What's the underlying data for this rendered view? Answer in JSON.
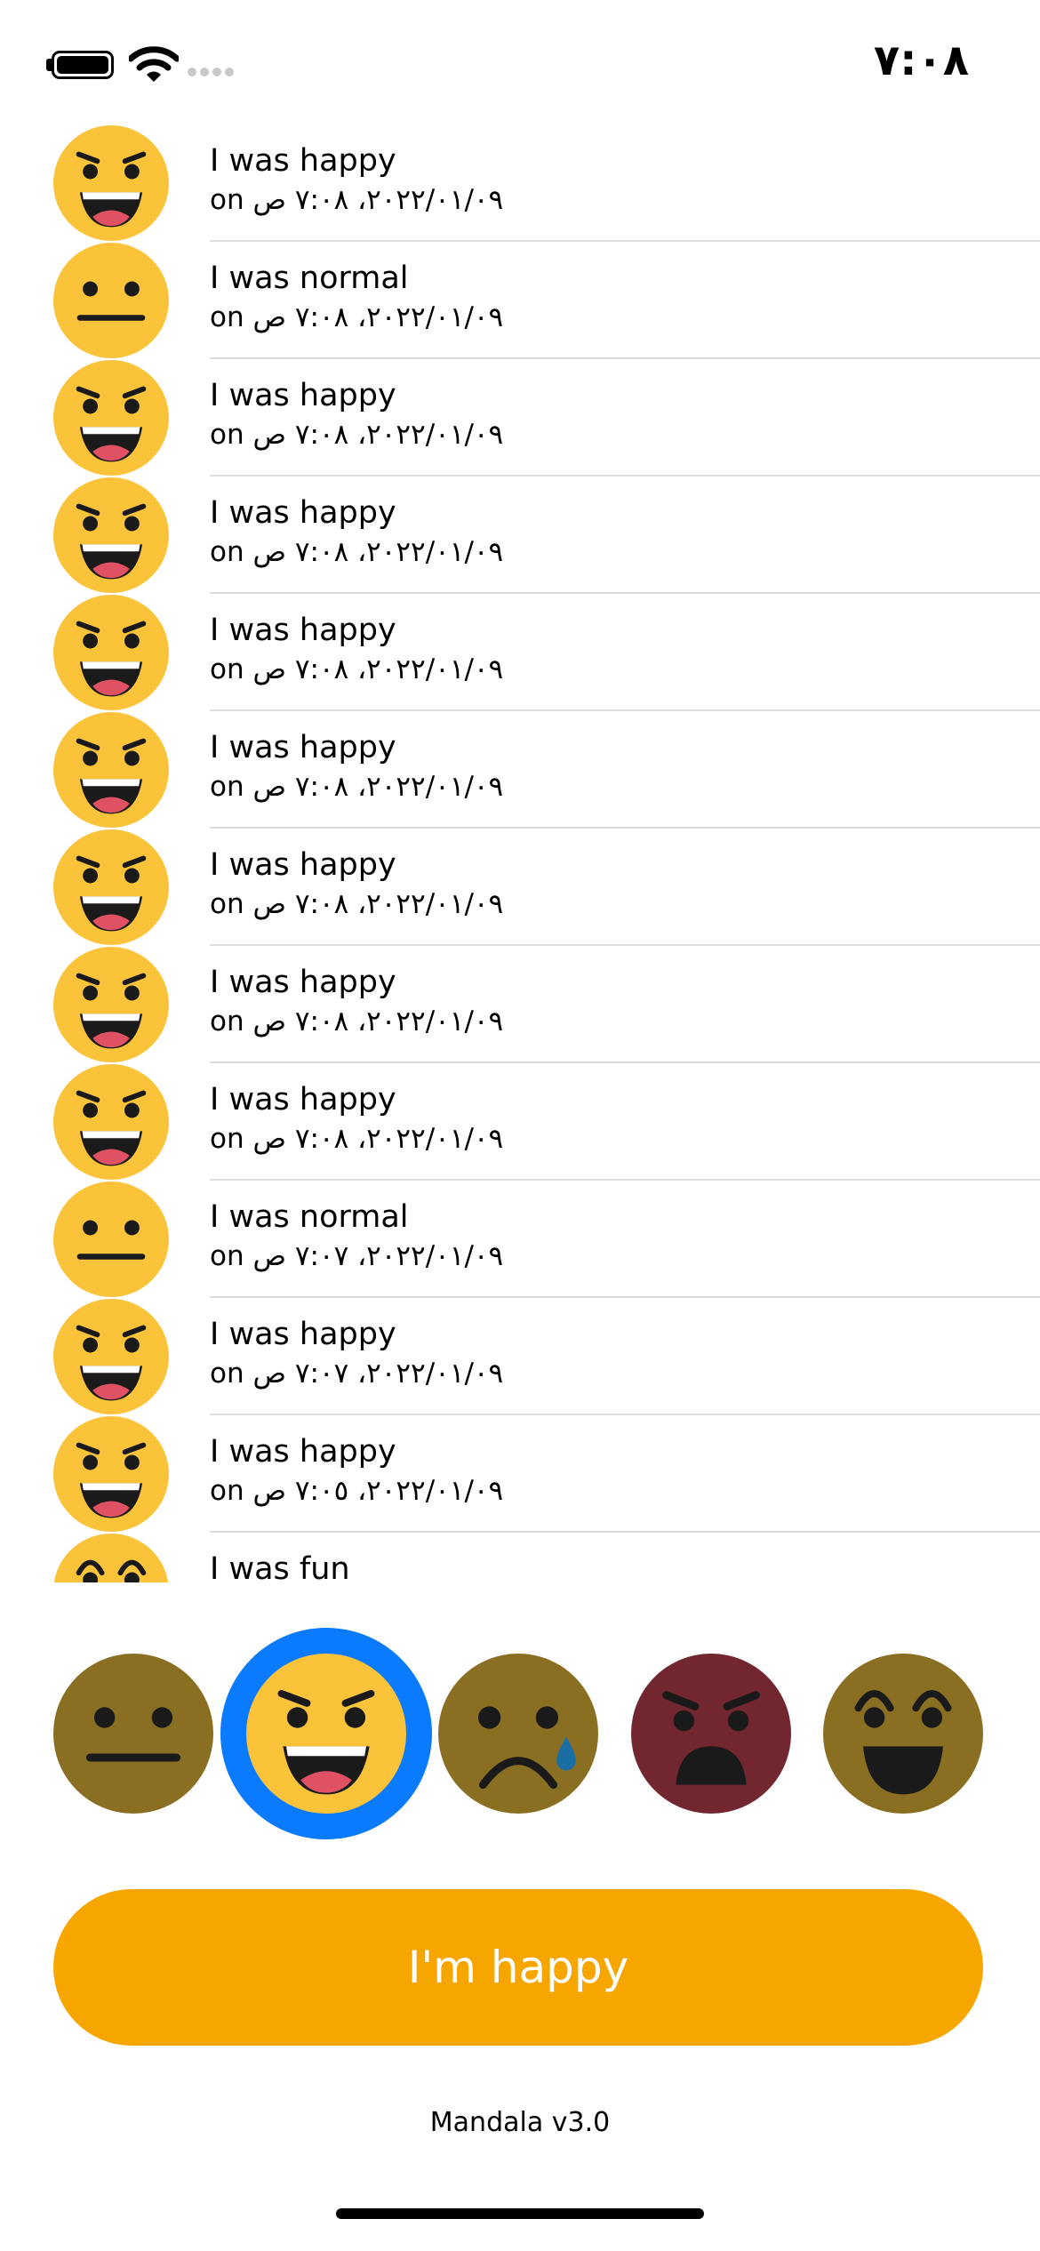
{
  "status_bar": {
    "time": "٧:٠٨",
    "icons": [
      "battery-icon",
      "wifi-icon",
      "cellular-signal-icon"
    ]
  },
  "history": [
    {
      "mood": "happy",
      "title": "I was happy",
      "prefix": "on",
      "datetime": "٢٠٢٢/٠١/٠٩، ٧:٠٨ ص"
    },
    {
      "mood": "normal",
      "title": "I was normal",
      "prefix": "on",
      "datetime": "٢٠٢٢/٠١/٠٩، ٧:٠٨ ص"
    },
    {
      "mood": "happy",
      "title": "I was happy",
      "prefix": "on",
      "datetime": "٢٠٢٢/٠١/٠٩، ٧:٠٨ ص"
    },
    {
      "mood": "happy",
      "title": "I was happy",
      "prefix": "on",
      "datetime": "٢٠٢٢/٠١/٠٩، ٧:٠٨ ص"
    },
    {
      "mood": "happy",
      "title": "I was happy",
      "prefix": "on",
      "datetime": "٢٠٢٢/٠١/٠٩، ٧:٠٨ ص"
    },
    {
      "mood": "happy",
      "title": "I was happy",
      "prefix": "on",
      "datetime": "٢٠٢٢/٠١/٠٩، ٧:٠٨ ص"
    },
    {
      "mood": "happy",
      "title": "I was happy",
      "prefix": "on",
      "datetime": "٢٠٢٢/٠١/٠٩، ٧:٠٨ ص"
    },
    {
      "mood": "happy",
      "title": "I was happy",
      "prefix": "on",
      "datetime": "٢٠٢٢/٠١/٠٩، ٧:٠٨ ص"
    },
    {
      "mood": "happy",
      "title": "I was happy",
      "prefix": "on",
      "datetime": "٢٠٢٢/٠١/٠٩، ٧:٠٨ ص"
    },
    {
      "mood": "normal",
      "title": "I was normal",
      "prefix": "on",
      "datetime": "٢٠٢٢/٠١/٠٩، ٧:٠٧ ص"
    },
    {
      "mood": "happy",
      "title": "I was happy",
      "prefix": "on",
      "datetime": "٢٠٢٢/٠١/٠٩، ٧:٠٧ ص"
    },
    {
      "mood": "happy",
      "title": "I was happy",
      "prefix": "on",
      "datetime": "٢٠٢٢/٠١/٠٩، ٧:٠٥ ص"
    },
    {
      "mood": "fun",
      "title": "I was fun",
      "prefix": "",
      "datetime": ""
    }
  ],
  "mood_picker": {
    "options": [
      {
        "mood": "normal",
        "icon": "neutral-face-icon",
        "selected": false
      },
      {
        "mood": "happy",
        "icon": "happy-face-icon",
        "selected": true
      },
      {
        "mood": "sad",
        "icon": "sad-face-icon",
        "selected": false
      },
      {
        "mood": "angry",
        "icon": "angry-face-icon",
        "selected": false
      },
      {
        "mood": "fun",
        "icon": "fun-face-icon",
        "selected": false
      }
    ]
  },
  "action_button": {
    "label": "I'm happy"
  },
  "footer": {
    "version": "Mandala v3.0"
  },
  "colors": {
    "face_yellow": "#fbc33a",
    "face_dim_olive": "#8a6e22",
    "face_angry": "#722630",
    "selection_ring": "#0a7aff",
    "button": "#f7a600",
    "tongue": "#e05263",
    "tear": "#1b6ea3"
  }
}
